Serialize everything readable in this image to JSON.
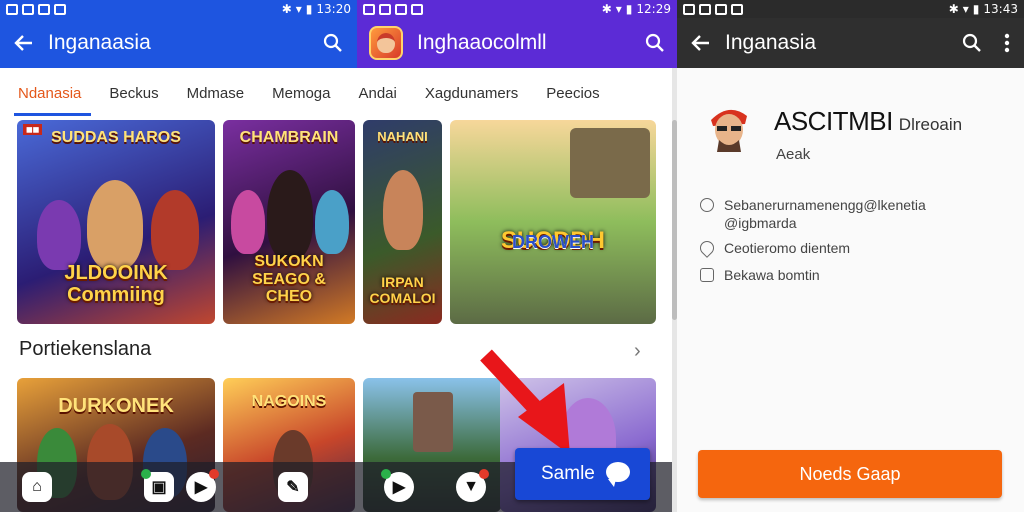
{
  "screens": [
    {
      "status": {
        "time": "13:20"
      },
      "appbar": {
        "title": "Inganaasia"
      },
      "tabs": [
        "Ndanasia",
        "Beckus",
        "Mdmase",
        "Memoga"
      ],
      "cards_row1": [
        {
          "top": "SUDDAS HAROS",
          "caption": "JLDOOINK Commiing"
        },
        {
          "top": "CHAMBRAIN",
          "caption": "SUKOKN SEAGO & CHEO"
        },
        {
          "top": "NAHANI",
          "caption": "IRPAN COMALOI"
        }
      ],
      "section": {
        "title": "Portiekenslana"
      }
    },
    {
      "status": {
        "time": "12:29"
      },
      "appbar": {
        "title": "Inghaaocolmll"
      },
      "tabs": [
        "Andai",
        "Xagdunamers",
        "Peecios"
      ],
      "card": {
        "caption": "SUODDH",
        "sub": "DROWEH"
      },
      "button": {
        "label": "Samle"
      }
    },
    {
      "status": {
        "time": "13:43"
      },
      "appbar": {
        "title": "Inganasia"
      },
      "profile": {
        "name": "ASCITMBI",
        "name_suffix": "Dlreoain",
        "subtitle": "Aeak",
        "email_line1": "Sebanerurnamenengg@lkenetia",
        "email_line2": "@igbmarda",
        "heart_text": "Ceotieromo dientem",
        "phone_text": "Bekawa bomtin"
      },
      "primary_button": {
        "label": "Noeds Gaap"
      }
    }
  ],
  "cards_row2": [
    {
      "caption": "DURKONEK"
    },
    {
      "caption": "NAGOINS"
    },
    {
      "caption": ""
    },
    {
      "caption": ""
    }
  ],
  "colors": {
    "blue_bar": "#1e55e0",
    "purple_bar": "#5c2bd6",
    "dark_bar": "#2f2f2f",
    "accent_orange": "#f5660e",
    "active_tab": "#e4581b",
    "arrow_red": "#e8161a"
  },
  "icons": {
    "back": "arrow-left-icon",
    "search": "search-icon",
    "more": "more-vert-icon",
    "chevron": "chevron-right-icon",
    "chat": "chat-bubble-icon"
  }
}
